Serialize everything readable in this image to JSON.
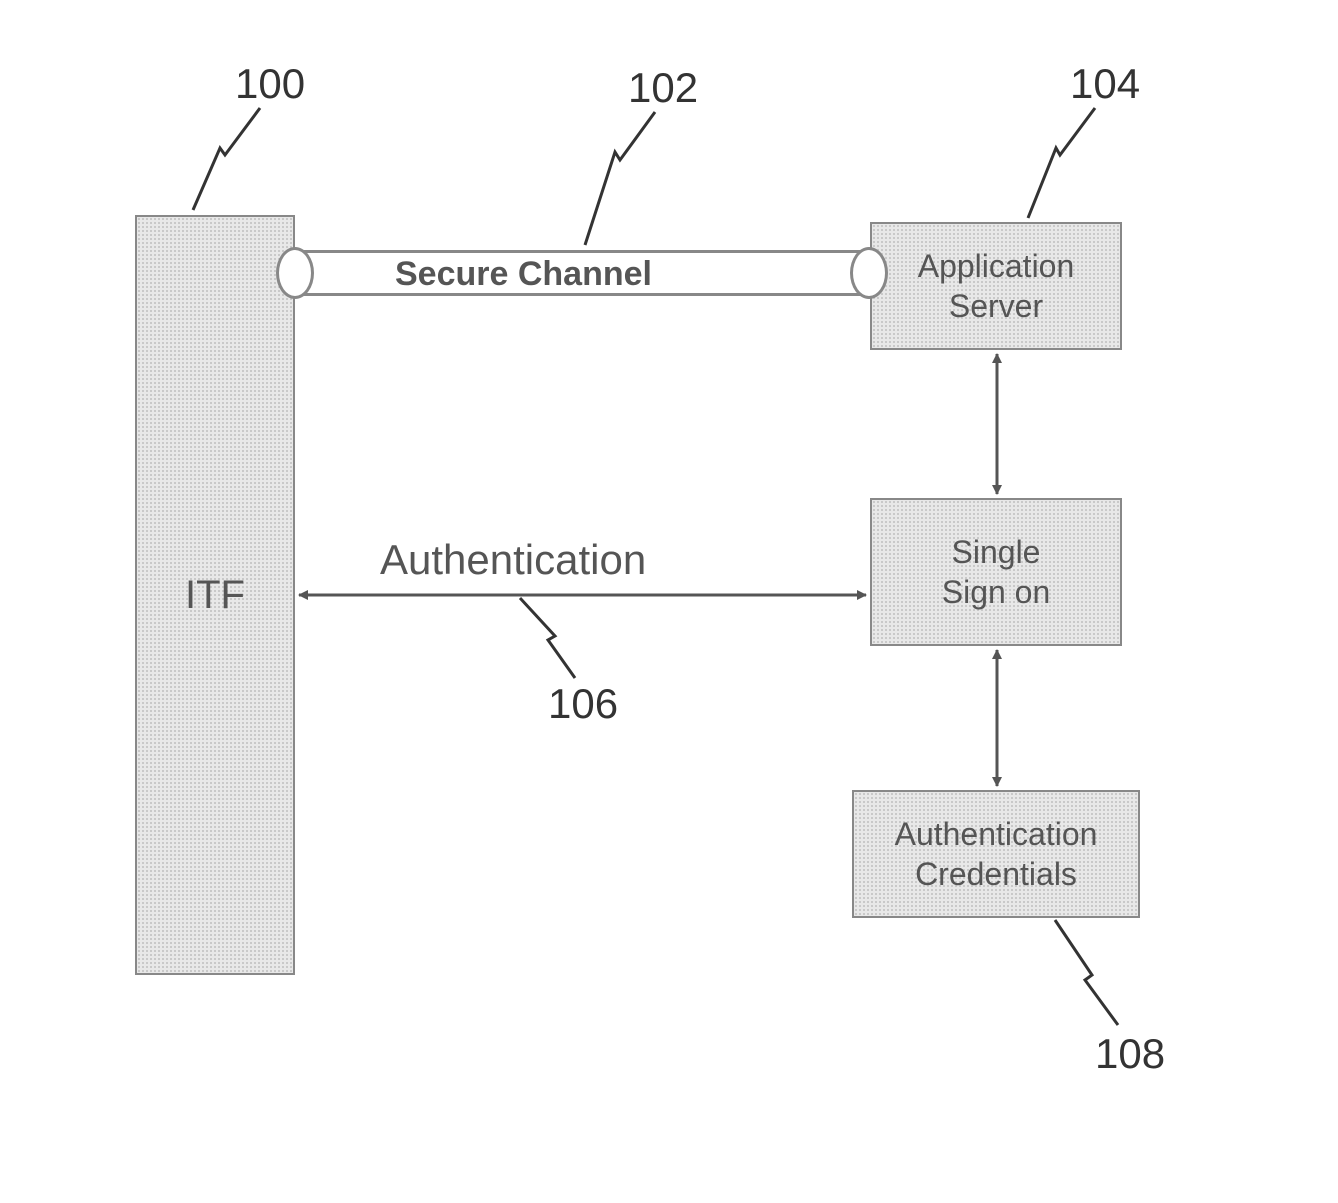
{
  "refs": {
    "r100": "100",
    "r102": "102",
    "r104": "104",
    "r106": "106",
    "r108": "108"
  },
  "boxes": {
    "itf": "ITF",
    "appServer": "Application\nServer",
    "sso": "Single\nSign on",
    "authCred": "Authentication\nCredentials"
  },
  "labels": {
    "secureChannel": "Secure Channel",
    "authentication": "Authentication"
  }
}
